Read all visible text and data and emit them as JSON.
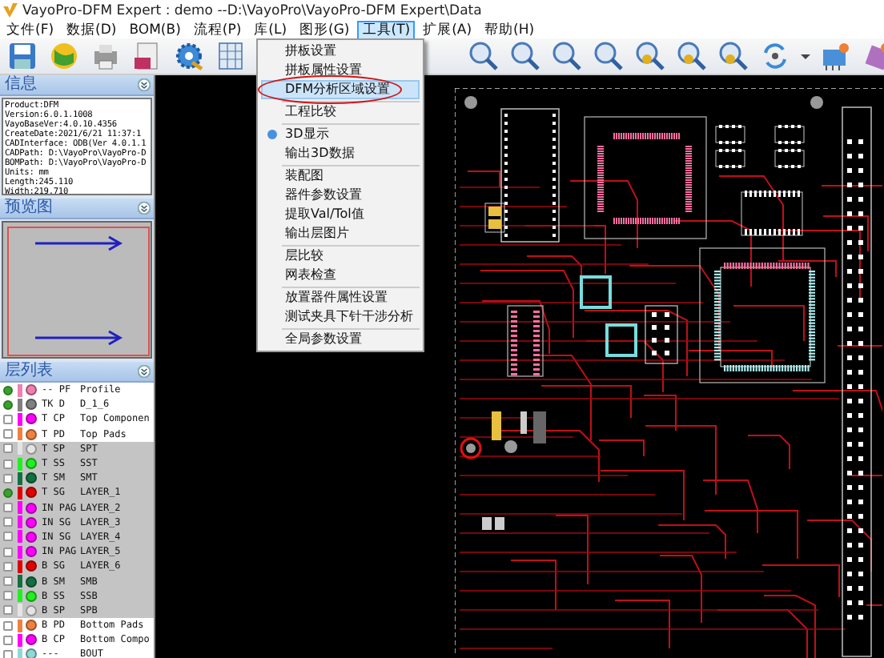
{
  "window": {
    "title": "VayoPro-DFM Expert : demo  --D:\\VayoPro\\VayoPro-DFM Expert\\Data"
  },
  "menubar": [
    {
      "label": "文件(F)",
      "selected": false
    },
    {
      "label": "数据(D)",
      "selected": false
    },
    {
      "label": "BOM(B)",
      "selected": false
    },
    {
      "label": "流程(P)",
      "selected": false
    },
    {
      "label": "库(L)",
      "selected": false
    },
    {
      "label": "图形(G)",
      "selected": false
    },
    {
      "label": "工具(T)",
      "selected": true
    },
    {
      "label": "扩展(A)",
      "selected": false
    },
    {
      "label": "帮助(H)",
      "selected": false
    }
  ],
  "tools_menu": [
    {
      "kind": "item",
      "label": "拼板设置",
      "selected": false,
      "circled": false
    },
    {
      "kind": "item",
      "label": "拼板属性设置",
      "selected": false,
      "circled": false
    },
    {
      "kind": "item",
      "label": "DFM分析区域设置",
      "selected": true,
      "circled": true
    },
    {
      "kind": "separator"
    },
    {
      "kind": "item",
      "label": "工程比较",
      "selected": false,
      "circled": false
    },
    {
      "kind": "separator"
    },
    {
      "kind": "item_with_icon",
      "label": "3D显示",
      "selected": false,
      "circled": false
    },
    {
      "kind": "item",
      "label": "输出3D数据",
      "selected": false,
      "circled": false
    },
    {
      "kind": "separator"
    },
    {
      "kind": "item",
      "label": "装配图",
      "selected": false,
      "circled": false
    },
    {
      "kind": "item",
      "label": "器件参数设置",
      "selected": false,
      "circled": false
    },
    {
      "kind": "item",
      "label": "提取Val/Tol值",
      "selected": false,
      "circled": false
    },
    {
      "kind": "item",
      "label": "输出层图片",
      "selected": false,
      "circled": false
    },
    {
      "kind": "separator"
    },
    {
      "kind": "item",
      "label": "层比较",
      "selected": false,
      "circled": false
    },
    {
      "kind": "item",
      "label": "网表检查",
      "selected": false,
      "circled": false
    },
    {
      "kind": "separator"
    },
    {
      "kind": "item",
      "label": "放置器件属性设置",
      "selected": false,
      "circled": false
    },
    {
      "kind": "item",
      "label": "测试夹具下针干涉分析",
      "selected": false,
      "circled": false
    },
    {
      "kind": "separator"
    },
    {
      "kind": "item",
      "label": "全局参数设置",
      "selected": false,
      "circled": false
    }
  ],
  "info_panel": {
    "title": "信息",
    "lines": [
      "Product:DFM",
      "Version:6.0.1.1008",
      "VayoBaseVer:4.0.10.4356",
      "CreateDate:2021/6/21 11:37:1",
      "CADInterface: ODB(Ver 4.0.1.1",
      "CADPath: D:\\VayoPro\\VayoPro-D",
      "BOMPath: D:\\VayoPro\\VayoPro-D",
      "Units: mm",
      "Length:245.110",
      "Width:219.710"
    ]
  },
  "preview_panel": {
    "title": "预览图"
  },
  "layer_panel": {
    "title": "层列表",
    "layers": [
      {
        "checked": true,
        "selected": false,
        "color": "#f080b0",
        "code": "-- PF",
        "name": "Profile"
      },
      {
        "checked": true,
        "selected": false,
        "color": "#808080",
        "code": "TK D",
        "name": "D_1_6"
      },
      {
        "checked": false,
        "selected": false,
        "color": "#ff00ff",
        "code": "T CP",
        "name": "Top Componen"
      },
      {
        "checked": false,
        "selected": false,
        "color": "#f08040",
        "code": "T PD",
        "name": "Top Pads"
      },
      {
        "checked": false,
        "selected": true,
        "color": "#e4e4e4",
        "code": "T SP",
        "name": "SPT"
      },
      {
        "checked": false,
        "selected": true,
        "color": "#20f020",
        "code": "T SS",
        "name": "SST"
      },
      {
        "checked": false,
        "selected": true,
        "color": "#107040",
        "code": "T SM",
        "name": "SMT"
      },
      {
        "checked": true,
        "selected": true,
        "color": "#e00000",
        "code": "T SG",
        "name": "LAYER_1"
      },
      {
        "checked": false,
        "selected": true,
        "color": "#ff00ff",
        "code": "IN PAG",
        "name": "LAYER_2"
      },
      {
        "checked": false,
        "selected": true,
        "color": "#ff00ff",
        "code": "IN SG",
        "name": "LAYER_3"
      },
      {
        "checked": false,
        "selected": true,
        "color": "#ff00ff",
        "code": "IN SG",
        "name": "LAYER_4"
      },
      {
        "checked": false,
        "selected": true,
        "color": "#ff00ff",
        "code": "IN PAG",
        "name": "LAYER_5"
      },
      {
        "checked": false,
        "selected": true,
        "color": "#e00000",
        "code": "B SG",
        "name": "LAYER_6"
      },
      {
        "checked": false,
        "selected": true,
        "color": "#107040",
        "code": "B SM",
        "name": "SMB"
      },
      {
        "checked": false,
        "selected": true,
        "color": "#20f020",
        "code": "B SS",
        "name": "SSB"
      },
      {
        "checked": false,
        "selected": true,
        "color": "#e4e4e4",
        "code": "B SP",
        "name": "SPB"
      },
      {
        "checked": false,
        "selected": false,
        "color": "#f08040",
        "code": "B PD",
        "name": "Bottom Pads"
      },
      {
        "checked": false,
        "selected": false,
        "color": "#ff00ff",
        "code": "B CP",
        "name": "Bottom Compo"
      },
      {
        "checked": false,
        "selected": false,
        "color": "#90d8d8",
        "code": "---",
        "name": "BOUT"
      }
    ]
  }
}
